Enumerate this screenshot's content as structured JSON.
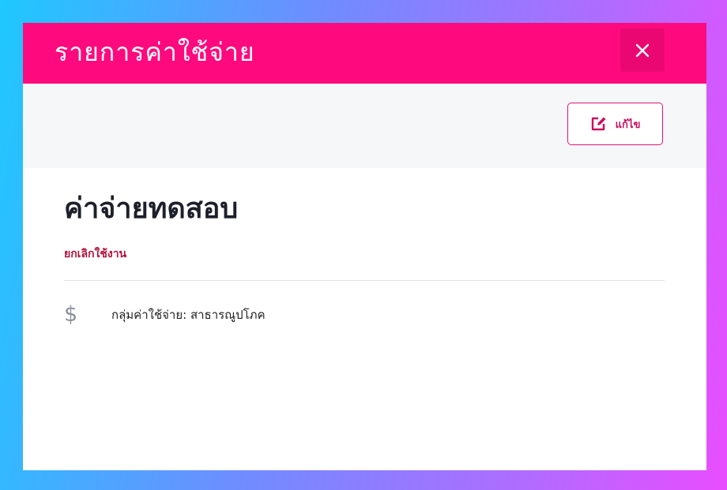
{
  "modal": {
    "title": "รายการค่าใช้จ่าย",
    "close_icon": "close-icon"
  },
  "toolbar": {
    "edit_label": "แก้ไข",
    "edit_icon": "edit-icon"
  },
  "item": {
    "name": "ค่าจ่ายทดสอบ",
    "status": "ยกเลิกใช้งาน",
    "group_label": "กลุ่มค่าใช้จ่าย:",
    "group_value": "สาธารณูปโภค",
    "group_icon": "dollar-icon"
  },
  "colors": {
    "header": "#ff0a7e",
    "accent": "#e0136f",
    "status": "#b1123b"
  }
}
